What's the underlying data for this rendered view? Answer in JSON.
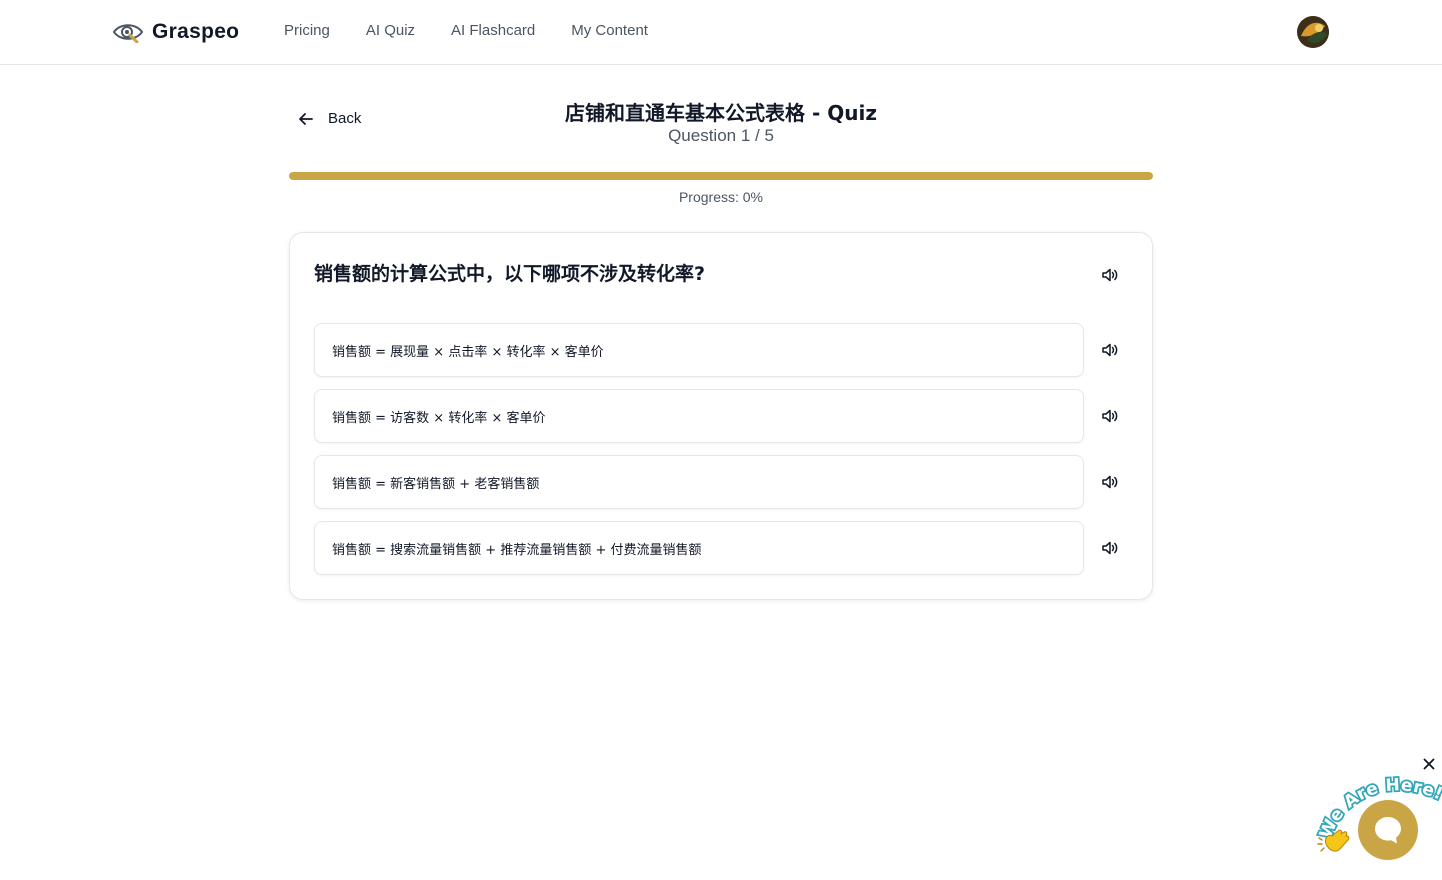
{
  "header": {
    "brand": "Graspeo",
    "nav": [
      "Pricing",
      "AI Quiz",
      "AI Flashcard",
      "My Content"
    ]
  },
  "quiz": {
    "back_label": "Back",
    "title": "店铺和直通车基本公式表格 - Quiz",
    "counter": "Question 1 / 5",
    "progress_label": "Progress: 0%",
    "progress_fraction": 0,
    "question": "销售额的计算公式中，以下哪项不涉及转化率?",
    "options": [
      "销售额 = 展现量 × 点击率 × 转化率 × 客单价",
      "销售额 = 访客数 × 转化率 × 客单价",
      "销售额 = 新客销售额 + 老客销售额",
      "销售额 = 搜索流量销售额 + 推荐流量销售额 + 付费流量销售额"
    ]
  },
  "chat_widget": {
    "badge_text": "We Are Here!"
  },
  "colors": {
    "accent": "#c9a545",
    "progress_track": "#ead9a8"
  },
  "icons": [
    "eye-logo-icon",
    "arrow-left-icon",
    "speaker-icon",
    "close-icon",
    "chat-icon",
    "waving-hand-icon"
  ]
}
